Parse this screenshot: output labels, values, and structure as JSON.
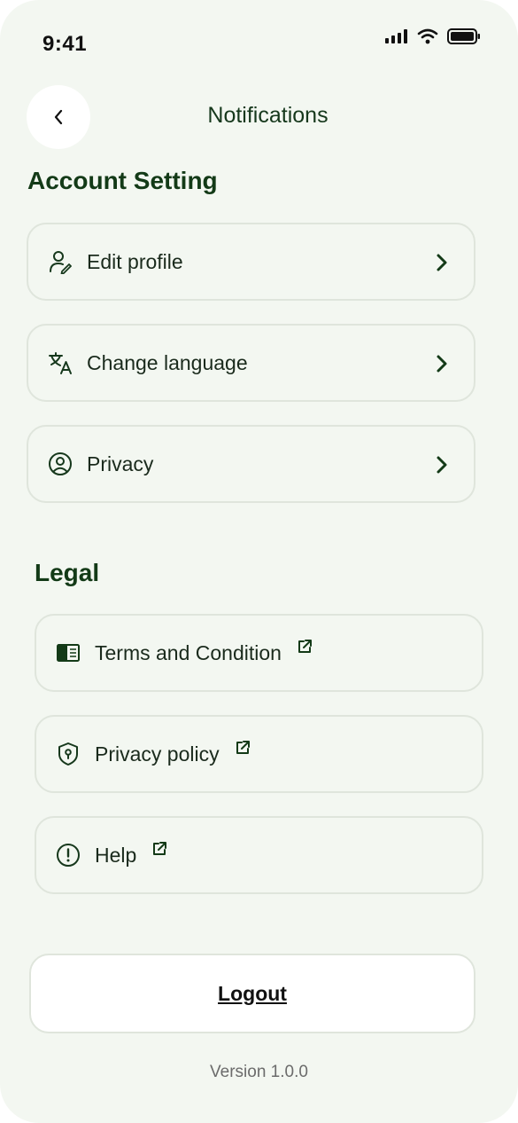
{
  "status_bar": {
    "time": "9:41"
  },
  "header": {
    "title": "Notifications"
  },
  "account_section": {
    "title": "Account Setting",
    "items": [
      {
        "label": "Edit profile",
        "icon": "user-edit-icon"
      },
      {
        "label": "Change language",
        "icon": "translate-icon"
      },
      {
        "label": "Privacy",
        "icon": "user-circle-icon"
      }
    ]
  },
  "legal_section": {
    "title": "Legal",
    "items": [
      {
        "label": "Terms and Condition",
        "icon": "document-icon"
      },
      {
        "label": "Privacy policy",
        "icon": "shield-icon"
      },
      {
        "label": "Help",
        "icon": "info-circle-icon"
      }
    ]
  },
  "logout": {
    "label": "Logout"
  },
  "footer": {
    "version": "Version 1.0.0"
  },
  "colors": {
    "background": "#f3f7f1",
    "accent": "#133a17",
    "card_border": "#dfe5dc",
    "white": "#ffffff"
  }
}
